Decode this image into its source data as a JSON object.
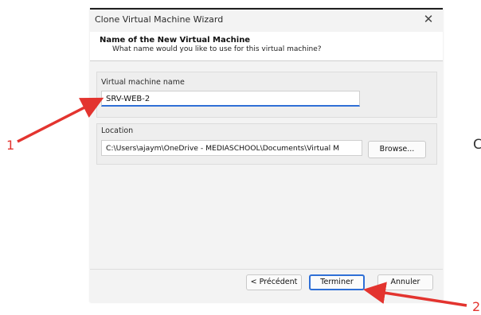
{
  "dialog": {
    "title": "Clone Virtual Machine Wizard",
    "close_glyph": "✕",
    "header_title": "Name of the New Virtual Machine",
    "header_subtitle": "What name would you like to use for this virtual machine?"
  },
  "name_group": {
    "label": "Virtual machine name",
    "value": "SRV-WEB-2"
  },
  "location_group": {
    "label": "Location",
    "value": "C:\\Users\\ajaym\\OneDrive - MEDIASCHOOL\\Documents\\Virtual M",
    "browse_label": "Browse..."
  },
  "footer": {
    "back_label": "< Précédent",
    "finish_label": "Terminer",
    "cancel_label": "Annuler"
  },
  "annotations": {
    "callout_1": "1",
    "callout_2": "2",
    "side_letter": "C",
    "arrow_color": "#e3342f"
  },
  "colors": {
    "accent": "#2f6fd6",
    "dialog_bg": "#f3f3f3"
  }
}
